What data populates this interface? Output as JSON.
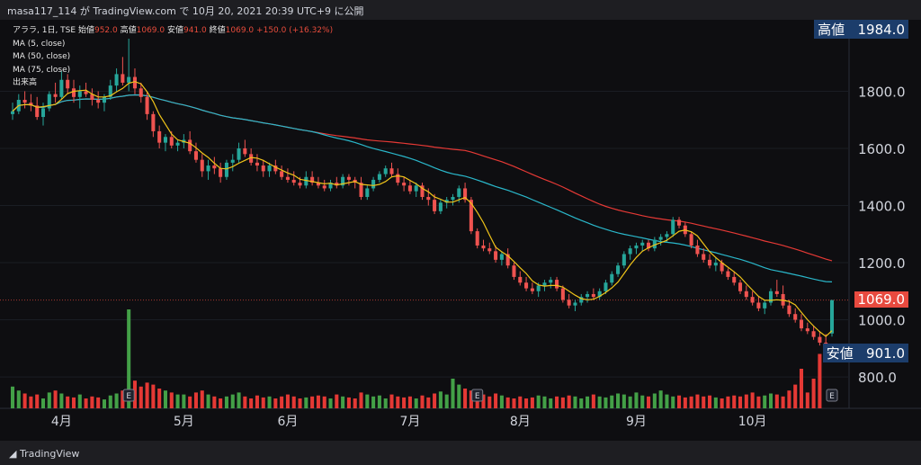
{
  "header": {
    "text": "masa117_114 が TradingView.com で 10月 20, 2021 20:39 UTC+9 に公開"
  },
  "legend": {
    "symbol": "アララ, 1日, TSE",
    "open_label": "始値",
    "open": "952.0",
    "high_label": "高値",
    "high": "1069.0",
    "low_label": "安値",
    "low": "941.0",
    "close_label": "終値",
    "close": "1069.0",
    "change": "+150.0 (+16.32%)",
    "ma5": "MA (5, close)",
    "ma50": "MA (50, close)",
    "ma75": "MA (75, close)",
    "volume": "出来高"
  },
  "axis_badges": {
    "high_label": "高値",
    "high_value": "1984.0",
    "last_value": "1069.0",
    "low_label": "安値",
    "low_value": "901.0"
  },
  "footer": {
    "brand": "TradingView"
  },
  "colors": {
    "background": "#0e0e11",
    "up": "#26a69a",
    "down": "#ef5350",
    "ma5": "#f0c419",
    "ma50": "#2ab7ca",
    "ma75": "#e53935",
    "vol_up": "#43a047",
    "vol_down": "#e53935",
    "badge": "#1c3d6b",
    "last_badge": "#e84a3f"
  },
  "chart_data": {
    "type": "candlestick",
    "y_ticks": [
      "800.0",
      "1000.0",
      "1200.0",
      "1400.0",
      "1600.0",
      "1800.0"
    ],
    "y_tick_values": [
      800,
      1000,
      1200,
      1400,
      1600,
      1800
    ],
    "ylim": [
      690,
      2025
    ],
    "x_month_labels": [
      "4月",
      "5月",
      "6月",
      "7月",
      "8月",
      "9月",
      "10月"
    ],
    "x_month_start_index": [
      8,
      28,
      45,
      65,
      83,
      102,
      121
    ],
    "earnings_marker_label": "E",
    "earnings_index": [
      19,
      76,
      134
    ],
    "ohlc": [
      [
        1720,
        1760,
        1700,
        1730
      ],
      [
        1730,
        1790,
        1720,
        1770
      ],
      [
        1770,
        1800,
        1740,
        1760
      ],
      [
        1760,
        1790,
        1730,
        1750
      ],
      [
        1750,
        1780,
        1700,
        1710
      ],
      [
        1710,
        1760,
        1680,
        1740
      ],
      [
        1740,
        1800,
        1730,
        1790
      ],
      [
        1790,
        1830,
        1760,
        1780
      ],
      [
        1780,
        1870,
        1770,
        1840
      ],
      [
        1840,
        1860,
        1790,
        1810
      ],
      [
        1810,
        1840,
        1760,
        1780
      ],
      [
        1780,
        1820,
        1740,
        1800
      ],
      [
        1800,
        1830,
        1780,
        1790
      ],
      [
        1790,
        1810,
        1750,
        1770
      ],
      [
        1770,
        1800,
        1740,
        1760
      ],
      [
        1760,
        1790,
        1730,
        1780
      ],
      [
        1780,
        1840,
        1770,
        1820
      ],
      [
        1820,
        1880,
        1800,
        1860
      ],
      [
        1860,
        1920,
        1820,
        1830
      ],
      [
        1830,
        1984,
        1800,
        1850
      ],
      [
        1850,
        1880,
        1790,
        1810
      ],
      [
        1810,
        1830,
        1760,
        1780
      ],
      [
        1780,
        1800,
        1700,
        1720
      ],
      [
        1720,
        1730,
        1640,
        1660
      ],
      [
        1660,
        1680,
        1600,
        1620
      ],
      [
        1620,
        1650,
        1590,
        1640
      ],
      [
        1640,
        1660,
        1600,
        1610
      ],
      [
        1610,
        1630,
        1590,
        1620
      ],
      [
        1620,
        1650,
        1600,
        1630
      ],
      [
        1630,
        1660,
        1580,
        1590
      ],
      [
        1590,
        1620,
        1550,
        1560
      ],
      [
        1560,
        1580,
        1500,
        1520
      ],
      [
        1520,
        1560,
        1490,
        1540
      ],
      [
        1540,
        1570,
        1510,
        1530
      ],
      [
        1530,
        1550,
        1480,
        1500
      ],
      [
        1500,
        1560,
        1490,
        1550
      ],
      [
        1550,
        1580,
        1520,
        1560
      ],
      [
        1560,
        1620,
        1550,
        1600
      ],
      [
        1600,
        1630,
        1570,
        1580
      ],
      [
        1580,
        1600,
        1540,
        1550
      ],
      [
        1550,
        1580,
        1520,
        1540
      ],
      [
        1540,
        1560,
        1500,
        1520
      ],
      [
        1520,
        1550,
        1500,
        1540
      ],
      [
        1540,
        1560,
        1510,
        1520
      ],
      [
        1520,
        1540,
        1490,
        1500
      ],
      [
        1500,
        1530,
        1480,
        1490
      ],
      [
        1490,
        1520,
        1470,
        1480
      ],
      [
        1480,
        1500,
        1460,
        1470
      ],
      [
        1470,
        1520,
        1460,
        1500
      ],
      [
        1500,
        1520,
        1470,
        1480
      ],
      [
        1480,
        1500,
        1460,
        1470
      ],
      [
        1470,
        1490,
        1450,
        1460
      ],
      [
        1460,
        1490,
        1450,
        1480
      ],
      [
        1480,
        1500,
        1460,
        1470
      ],
      [
        1470,
        1510,
        1460,
        1500
      ],
      [
        1500,
        1510,
        1470,
        1490
      ],
      [
        1490,
        1500,
        1460,
        1480
      ],
      [
        1480,
        1500,
        1420,
        1430
      ],
      [
        1430,
        1470,
        1420,
        1460
      ],
      [
        1460,
        1500,
        1450,
        1490
      ],
      [
        1490,
        1520,
        1480,
        1510
      ],
      [
        1510,
        1540,
        1500,
        1530
      ],
      [
        1530,
        1550,
        1500,
        1510
      ],
      [
        1510,
        1530,
        1470,
        1480
      ],
      [
        1480,
        1500,
        1450,
        1470
      ],
      [
        1470,
        1490,
        1440,
        1450
      ],
      [
        1450,
        1480,
        1430,
        1470
      ],
      [
        1470,
        1480,
        1420,
        1430
      ],
      [
        1430,
        1460,
        1400,
        1420
      ],
      [
        1420,
        1440,
        1370,
        1380
      ],
      [
        1380,
        1420,
        1370,
        1410
      ],
      [
        1410,
        1430,
        1390,
        1420
      ],
      [
        1420,
        1440,
        1400,
        1430
      ],
      [
        1430,
        1470,
        1410,
        1460
      ],
      [
        1460,
        1480,
        1410,
        1420
      ],
      [
        1420,
        1430,
        1300,
        1310
      ],
      [
        1310,
        1320,
        1250,
        1260
      ],
      [
        1260,
        1280,
        1240,
        1250
      ],
      [
        1250,
        1270,
        1230,
        1240
      ],
      [
        1240,
        1260,
        1200,
        1210
      ],
      [
        1210,
        1240,
        1190,
        1230
      ],
      [
        1230,
        1250,
        1180,
        1190
      ],
      [
        1190,
        1200,
        1140,
        1150
      ],
      [
        1150,
        1170,
        1120,
        1130
      ],
      [
        1130,
        1150,
        1100,
        1110
      ],
      [
        1110,
        1130,
        1090,
        1100
      ],
      [
        1100,
        1130,
        1080,
        1120
      ],
      [
        1120,
        1140,
        1100,
        1130
      ],
      [
        1130,
        1150,
        1110,
        1140
      ],
      [
        1140,
        1150,
        1100,
        1110
      ],
      [
        1110,
        1120,
        1060,
        1070
      ],
      [
        1070,
        1090,
        1040,
        1050
      ],
      [
        1050,
        1070,
        1030,
        1060
      ],
      [
        1060,
        1090,
        1050,
        1080
      ],
      [
        1080,
        1100,
        1060,
        1090
      ],
      [
        1090,
        1110,
        1070,
        1080
      ],
      [
        1080,
        1110,
        1070,
        1100
      ],
      [
        1100,
        1140,
        1090,
        1130
      ],
      [
        1130,
        1170,
        1120,
        1160
      ],
      [
        1160,
        1200,
        1150,
        1190
      ],
      [
        1190,
        1240,
        1180,
        1230
      ],
      [
        1230,
        1260,
        1210,
        1250
      ],
      [
        1250,
        1270,
        1230,
        1260
      ],
      [
        1260,
        1280,
        1240,
        1270
      ],
      [
        1270,
        1280,
        1240,
        1250
      ],
      [
        1250,
        1290,
        1240,
        1280
      ],
      [
        1280,
        1300,
        1260,
        1290
      ],
      [
        1290,
        1310,
        1270,
        1300
      ],
      [
        1300,
        1360,
        1290,
        1350
      ],
      [
        1350,
        1360,
        1320,
        1330
      ],
      [
        1330,
        1340,
        1290,
        1300
      ],
      [
        1300,
        1310,
        1250,
        1260
      ],
      [
        1260,
        1280,
        1220,
        1230
      ],
      [
        1230,
        1250,
        1200,
        1210
      ],
      [
        1210,
        1230,
        1180,
        1190
      ],
      [
        1190,
        1220,
        1170,
        1200
      ],
      [
        1200,
        1210,
        1160,
        1170
      ],
      [
        1170,
        1180,
        1140,
        1150
      ],
      [
        1150,
        1170,
        1120,
        1130
      ],
      [
        1130,
        1140,
        1090,
        1100
      ],
      [
        1100,
        1120,
        1070,
        1080
      ],
      [
        1080,
        1100,
        1050,
        1060
      ],
      [
        1060,
        1080,
        1030,
        1040
      ],
      [
        1040,
        1070,
        1020,
        1060
      ],
      [
        1060,
        1110,
        1050,
        1100
      ],
      [
        1100,
        1140,
        1080,
        1090
      ],
      [
        1090,
        1120,
        1040,
        1050
      ],
      [
        1050,
        1070,
        1010,
        1020
      ],
      [
        1020,
        1040,
        990,
        1000
      ],
      [
        1000,
        1020,
        960,
        970
      ],
      [
        970,
        990,
        950,
        960
      ],
      [
        960,
        980,
        930,
        940
      ],
      [
        940,
        960,
        910,
        920
      ],
      [
        920,
        950,
        901,
        919
      ],
      [
        952,
        1069,
        941,
        1069
      ]
    ],
    "volume": [
      22,
      18,
      15,
      12,
      14,
      10,
      16,
      18,
      15,
      12,
      11,
      14,
      10,
      12,
      11,
      9,
      13,
      15,
      18,
      100,
      28,
      22,
      26,
      24,
      20,
      18,
      16,
      14,
      14,
      12,
      16,
      18,
      14,
      12,
      10,
      12,
      14,
      16,
      12,
      10,
      13,
      11,
      12,
      10,
      12,
      14,
      12,
      10,
      11,
      12,
      13,
      12,
      10,
      14,
      12,
      11,
      10,
      16,
      14,
      12,
      13,
      10,
      14,
      12,
      11,
      12,
      10,
      13,
      11,
      15,
      17,
      14,
      30,
      24,
      20,
      18,
      16,
      14,
      12,
      15,
      13,
      11,
      10,
      12,
      10,
      11,
      13,
      12,
      10,
      12,
      11,
      13,
      12,
      10,
      12,
      14,
      12,
      11,
      13,
      15,
      14,
      12,
      16,
      13,
      12,
      15,
      18,
      14,
      12,
      13,
      11,
      12,
      14,
      12,
      13,
      11,
      10,
      12,
      13,
      12,
      14,
      16,
      12,
      13,
      15,
      14,
      12,
      18,
      24,
      40,
      16,
      30,
      55
    ]
  }
}
